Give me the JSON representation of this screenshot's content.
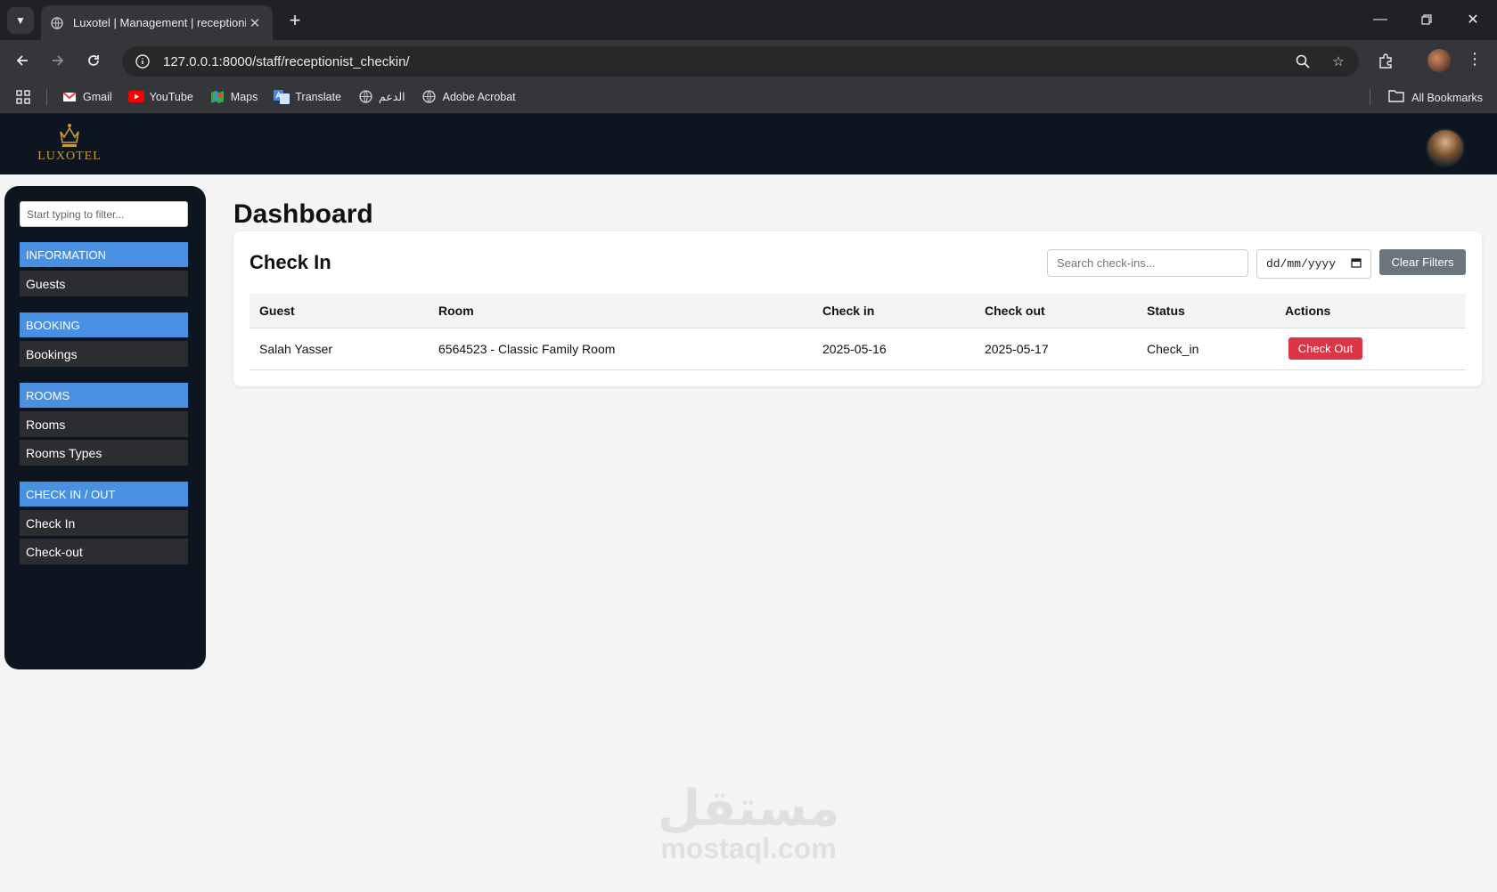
{
  "browser": {
    "tab_title": "Luxotel | Management | receptioni",
    "url": "127.0.0.1:8000/staff/receptionist_checkin/",
    "bookmarks": [
      {
        "label": "Gmail",
        "icon": "gmail-icon"
      },
      {
        "label": "YouTube",
        "icon": "youtube-icon"
      },
      {
        "label": "Maps",
        "icon": "maps-icon"
      },
      {
        "label": "Translate",
        "icon": "translate-icon"
      },
      {
        "label": "الدعم",
        "icon": "globe-icon"
      },
      {
        "label": "Adobe Acrobat",
        "icon": "globe-icon"
      }
    ],
    "all_bookmarks": "All Bookmarks"
  },
  "app": {
    "logo_text": "LUXOTEL",
    "brand_color": "#c89b3c"
  },
  "sidebar": {
    "filter_placeholder": "Start typing to filter...",
    "sections": [
      {
        "title": "INFORMATION",
        "items": [
          "Guests"
        ]
      },
      {
        "title": "BOOKING",
        "items": [
          "Bookings"
        ]
      },
      {
        "title": "ROOMS",
        "items": [
          "Rooms",
          "Rooms Types"
        ]
      },
      {
        "title": "CHECK IN / OUT",
        "items": [
          "Check In",
          "Check-out"
        ]
      }
    ],
    "accent": "#4a90e2"
  },
  "main": {
    "page_title": "Dashboard",
    "card_title": "Check In",
    "search_placeholder": "Search check-ins...",
    "date_placeholder": "dd/mm/yyyy",
    "clear_filters": "Clear Filters",
    "columns": [
      "Guest",
      "Room",
      "Check in",
      "Check out",
      "Status",
      "Actions"
    ],
    "rows": [
      {
        "guest": "Salah Yasser",
        "room": "6564523 - Classic Family Room",
        "check_in": "2025-05-16",
        "check_out": "2025-05-17",
        "status": "Check_in",
        "action": "Check Out"
      }
    ]
  },
  "watermark": {
    "arabic": "مستقل",
    "latin": "mostaql.com"
  }
}
